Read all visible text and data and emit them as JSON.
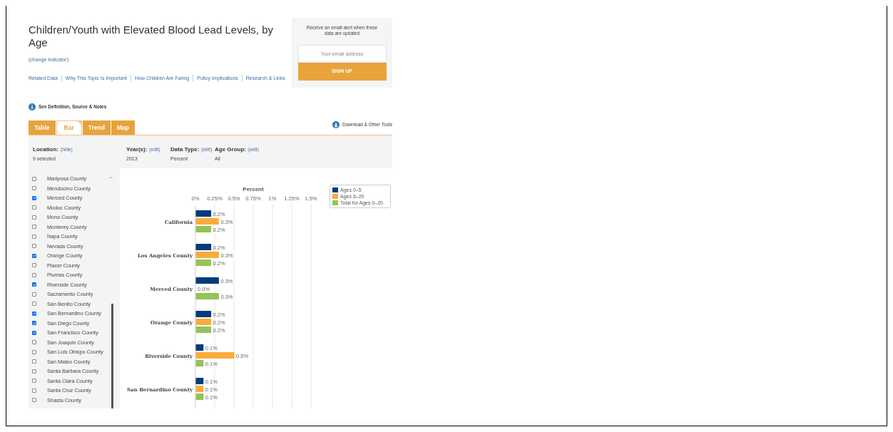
{
  "title": "Children/Youth with Elevated Blood Lead Levels, by Age",
  "change_link": "(change indicator)",
  "nav_links": [
    "Related Data",
    "Why This Topic Is Important",
    "How Children Are Faring",
    "Policy Implications",
    "Research & Links"
  ],
  "email_alert": {
    "text": "Receive an email alert when these data are updated",
    "placeholder": "Your email address",
    "button": "SIGN UP"
  },
  "definition_link": "See Definition, Source & Notes",
  "tabs": [
    {
      "label": "Table",
      "selected": false
    },
    {
      "label": "Bar",
      "selected": true
    },
    {
      "label": "Trend",
      "selected": false
    },
    {
      "label": "Map",
      "selected": false
    }
  ],
  "download_link": "Download & Other Tools",
  "filters": [
    {
      "label": "Location:",
      "action": "(hide)",
      "value": "9 selected"
    },
    {
      "label": "Year(s):",
      "action": "(edit)",
      "value": "2013"
    },
    {
      "label": "Data Type:",
      "action": "(edit)",
      "value": "Percent"
    },
    {
      "label": "Age Group:",
      "action": "(edit)",
      "value": "All"
    }
  ],
  "locations": [
    {
      "name": "Mariposa County",
      "checked": false
    },
    {
      "name": "Mendocino County",
      "checked": false
    },
    {
      "name": "Merced County",
      "checked": true
    },
    {
      "name": "Modoc County",
      "checked": false
    },
    {
      "name": "Mono County",
      "checked": false
    },
    {
      "name": "Monterey County",
      "checked": false
    },
    {
      "name": "Napa County",
      "checked": false
    },
    {
      "name": "Nevada County",
      "checked": false
    },
    {
      "name": "Orange County",
      "checked": true
    },
    {
      "name": "Placer County",
      "checked": false
    },
    {
      "name": "Plumas County",
      "checked": false
    },
    {
      "name": "Riverside County",
      "checked": true
    },
    {
      "name": "Sacramento County",
      "checked": false
    },
    {
      "name": "San Benito County",
      "checked": false
    },
    {
      "name": "San Bernardino County",
      "checked": true
    },
    {
      "name": "San Diego County",
      "checked": true
    },
    {
      "name": "San Francisco County",
      "checked": true
    },
    {
      "name": "San Joaquin County",
      "checked": false
    },
    {
      "name": "San Luis Obispo County",
      "checked": false
    },
    {
      "name": "San Mateo County",
      "checked": false
    },
    {
      "name": "Santa Barbara County",
      "checked": false
    },
    {
      "name": "Santa Clara County",
      "checked": false
    },
    {
      "name": "Santa Cruz County",
      "checked": false
    },
    {
      "name": "Shasta County",
      "checked": false
    }
  ],
  "chart_data": {
    "type": "bar",
    "orientation": "horizontal",
    "xlabel": "Percent",
    "categories": [
      "California",
      "Los Angeles County",
      "Merced County",
      "Orange County",
      "Riverside County",
      "San Bernardino County"
    ],
    "series": [
      {
        "name": "Ages 0–5",
        "color": "#003b7b",
        "values": [
          0.2,
          0.2,
          0.3,
          0.2,
          0.1,
          0.1
        ]
      },
      {
        "name": "Ages 6–20",
        "color": "#fbab3c",
        "values": [
          0.3,
          0.3,
          0.0,
          0.2,
          0.5,
          0.1
        ]
      },
      {
        "name": "Total for Ages 0–20",
        "color": "#94c356",
        "values": [
          0.2,
          0.2,
          0.3,
          0.2,
          0.1,
          0.1
        ]
      }
    ],
    "xlim": [
      0,
      1.5
    ],
    "grid": true,
    "legend": true,
    "xticks": [
      {
        "value": 0,
        "label": "0%"
      },
      {
        "value": 0.25,
        "label": "0.25%"
      },
      {
        "value": 0.5,
        "label": "0.5%"
      },
      {
        "value": 0.75,
        "label": "0.75%"
      },
      {
        "value": 1,
        "label": "1%"
      },
      {
        "value": 1.25,
        "label": "1.25%"
      },
      {
        "value": 1.5,
        "label": "1.5%"
      }
    ],
    "value_labels": [
      [
        "0.2%",
        "0.2%",
        "0.3%",
        "0.2%",
        "0.1%",
        "0.1%"
      ],
      [
        "0.3%",
        "0.3%",
        "0.0%",
        "0.2%",
        "0.5%",
        "0.1%"
      ],
      [
        "0.2%",
        "0.2%",
        "0.3%",
        "0.2%",
        "0.1%",
        "0.1%"
      ]
    ]
  }
}
